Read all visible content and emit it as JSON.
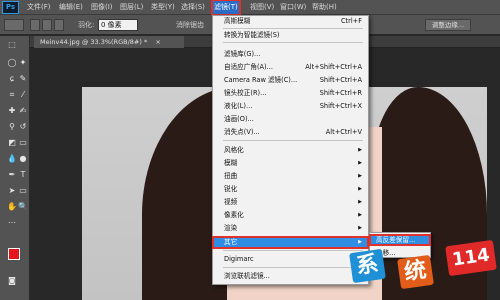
{
  "app": {
    "logo": "Ps"
  },
  "menubar": {
    "items": [
      "文件(F)",
      "编辑(E)",
      "图像(I)",
      "图层(L)",
      "类型(Y)",
      "选择(S)",
      "滤镜(T)",
      "视图(V)",
      "窗口(W)",
      "帮助(H)"
    ],
    "active_index": 6
  },
  "options": {
    "feather_label": "羽化:",
    "feather_value": "0 像素",
    "antialias_label": "消除锯齿",
    "refine_edge_label": "调整边缘..."
  },
  "document": {
    "tab_title": "Meinv44.jpg @ 33.3%(RGB/8#) *",
    "close_glyph": "×"
  },
  "filter_menu": {
    "items": [
      {
        "label": "高斯模糊",
        "shortcut": "Ctrl+F"
      },
      {
        "label": "转换为智能滤镜(S)",
        "shortcut": ""
      },
      {
        "label": "滤镜库(G)...",
        "shortcut": ""
      },
      {
        "label": "自适应广角(A)...",
        "shortcut": "Alt+Shift+Ctrl+A"
      },
      {
        "label": "Camera Raw 滤镜(C)...",
        "shortcut": "Shift+Ctrl+A"
      },
      {
        "label": "镜头校正(R)...",
        "shortcut": "Shift+Ctrl+R"
      },
      {
        "label": "液化(L)...",
        "shortcut": "Shift+Ctrl+X"
      },
      {
        "label": "油画(O)...",
        "shortcut": ""
      },
      {
        "label": "消失点(V)...",
        "shortcut": "Alt+Ctrl+V"
      },
      {
        "label": "风格化",
        "shortcut": ""
      },
      {
        "label": "模糊",
        "shortcut": ""
      },
      {
        "label": "扭曲",
        "shortcut": ""
      },
      {
        "label": "锐化",
        "shortcut": ""
      },
      {
        "label": "视频",
        "shortcut": ""
      },
      {
        "label": "像素化",
        "shortcut": ""
      },
      {
        "label": "渲染",
        "shortcut": ""
      },
      {
        "label": "杂色",
        "shortcut": ""
      },
      {
        "label": "其它",
        "shortcut": ""
      },
      {
        "label": "Digimarc",
        "shortcut": ""
      },
      {
        "label": "浏览联机滤镜...",
        "shortcut": ""
      }
    ],
    "highlighted": "其它"
  },
  "submenu": {
    "items": [
      "高反差保留...",
      "位移..."
    ]
  },
  "watermark": {
    "chars": [
      "系",
      "统",
      "114"
    ]
  },
  "colors": {
    "accent": "#2f8de3",
    "highlight_border": "#e0322a",
    "foreground": "#e3141b",
    "background": "#ffffff"
  }
}
